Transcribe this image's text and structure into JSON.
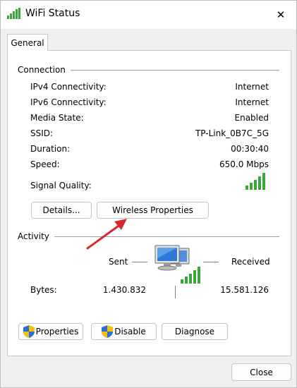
{
  "window": {
    "title": "WiFi Status",
    "close_glyph": "✕"
  },
  "tabs": [
    {
      "label": "General",
      "selected": true
    }
  ],
  "connection": {
    "heading": "Connection",
    "rows": [
      {
        "label": "IPv4 Connectivity:",
        "value": "Internet"
      },
      {
        "label": "IPv6 Connectivity:",
        "value": "Internet"
      },
      {
        "label": "Media State:",
        "value": "Enabled"
      },
      {
        "label": "SSID:",
        "value": "TP-Link_0B7C_5G"
      },
      {
        "label": "Duration:",
        "value": "00:30:40"
      },
      {
        "label": "Speed:",
        "value": "650.0 Mbps"
      }
    ],
    "signal_quality_label": "Signal Quality:",
    "signal_bars": 5,
    "details_button": "Details...",
    "wireless_properties_button": "Wireless Properties"
  },
  "activity": {
    "heading": "Activity",
    "sent_label": "Sent",
    "received_label": "Received",
    "bytes_label": "Bytes:",
    "bytes_sent": "1.430.832",
    "bytes_received": "15.581.126"
  },
  "actions": {
    "properties_button": "Properties",
    "disable_button": "Disable",
    "diagnose_button": "Diagnose"
  },
  "footer": {
    "close_button": "Close"
  },
  "colors": {
    "signal_green": "#3aa63a",
    "arrow_red": "#d42a2a",
    "shield_blue": "#2b6fd0",
    "shield_yellow": "#f4c20d"
  },
  "icons": {
    "title": "wifi-signal-icon",
    "network": "network-computers-icon",
    "shield": "uac-shield-icon",
    "close": "close-icon"
  }
}
